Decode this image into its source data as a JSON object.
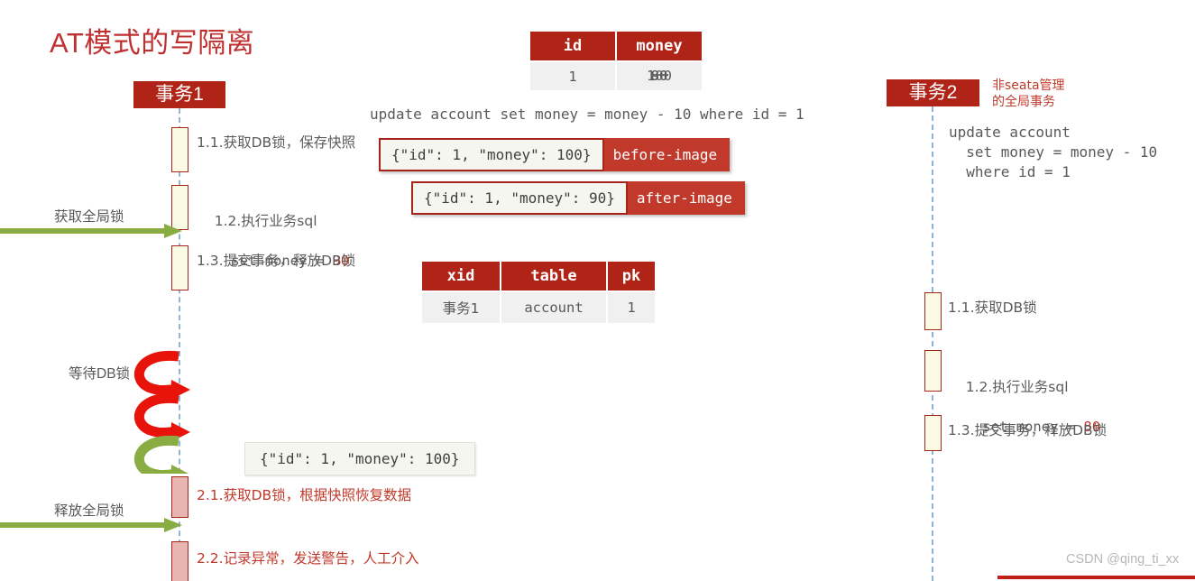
{
  "title": "AT模式的写隔离",
  "watermark": "CSDN @qing_ti_xx",
  "account_table": {
    "headers": [
      "id",
      "money"
    ],
    "row": {
      "id": "1",
      "money_values": [
        "100",
        "90",
        "80"
      ]
    }
  },
  "main_sql": "update account set money = money - 10 where id = 1",
  "images": {
    "before": {
      "json": "{\"id\": 1, \"money\": 100}",
      "tag": "before-image"
    },
    "after": {
      "json": "{\"id\": 1, \"money\": 90}",
      "tag": "after-image"
    },
    "snapshot": {
      "json": "{\"id\": 1, \"money\": 100}"
    }
  },
  "lock_table": {
    "headers": [
      "xid",
      "table",
      "pk"
    ],
    "row": {
      "xid": "事务1",
      "table": "account",
      "pk": "1"
    }
  },
  "tx1": {
    "name": "事务1",
    "steps": [
      {
        "label": "1.1.获取DB锁，保存快照"
      },
      {
        "label": "1.2.执行业务sql",
        "sub_prefix": "  set money = ",
        "sub_value": "90"
      },
      {
        "label": "1.3.提交事务，释放DB锁"
      },
      {
        "label": "2.1.获取DB锁，根据快照恢复数据"
      },
      {
        "label": "2.2.记录异常，发送警告，人工介入"
      }
    ],
    "side_labels": {
      "acquire_global_lock": "获取全局锁",
      "wait_db_lock": "等待DB锁",
      "release_global_lock": "释放全局锁"
    }
  },
  "tx2": {
    "name": "事务2",
    "annotation": "非seata管理\n的全局事务",
    "sql": "update account\n  set money = money - 10\n  where id = 1",
    "steps": [
      {
        "label": "1.1.获取DB锁"
      },
      {
        "label": "1.2.执行业务sql",
        "sub_prefix": "  set money = ",
        "sub_value": "80"
      },
      {
        "label": "1.3.提交事务，释放DB锁"
      }
    ]
  },
  "colors": {
    "brand_red": "#b02418",
    "accent_red": "#c0392b",
    "title_red": "#bf3030",
    "lifeline_blue": "#8fb4de",
    "activation_fill": "#fbfbe4",
    "rollback_fill": "#e8b4b0",
    "arrow_green": "#8aad43",
    "spiral_red": "#e8140c"
  }
}
